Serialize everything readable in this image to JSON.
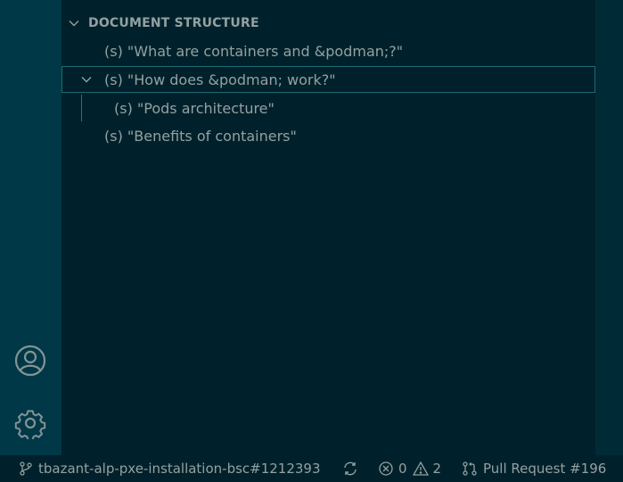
{
  "explorer": {
    "section_title": "DOCUMENT STRUCTURE",
    "items": [
      {
        "label": "(s) \"What are containers and &podman;?\""
      },
      {
        "label": "(s) \"How does &podman; work?\""
      },
      {
        "label": "(s) \"Pods architecture\""
      },
      {
        "label": "(s) \"Benefits of containers\""
      }
    ]
  },
  "status_bar": {
    "branch": "tbazant-alp-pxe-installation-bsc#1212393",
    "errors": "0",
    "warnings": "2",
    "pull_request": "Pull Request #196"
  },
  "icons": {
    "activity": [
      "account-icon",
      "settings-gear-icon"
    ],
    "status": [
      "git-branch-icon",
      "sync-icon",
      "error-icon",
      "warning-icon",
      "pull-request-icon"
    ]
  },
  "colors": {
    "background": "#002b36",
    "sidebar": "#00212b",
    "activity_bar": "#003847",
    "foreground": "#93a1a1",
    "selection_border": "#1f6a70"
  }
}
